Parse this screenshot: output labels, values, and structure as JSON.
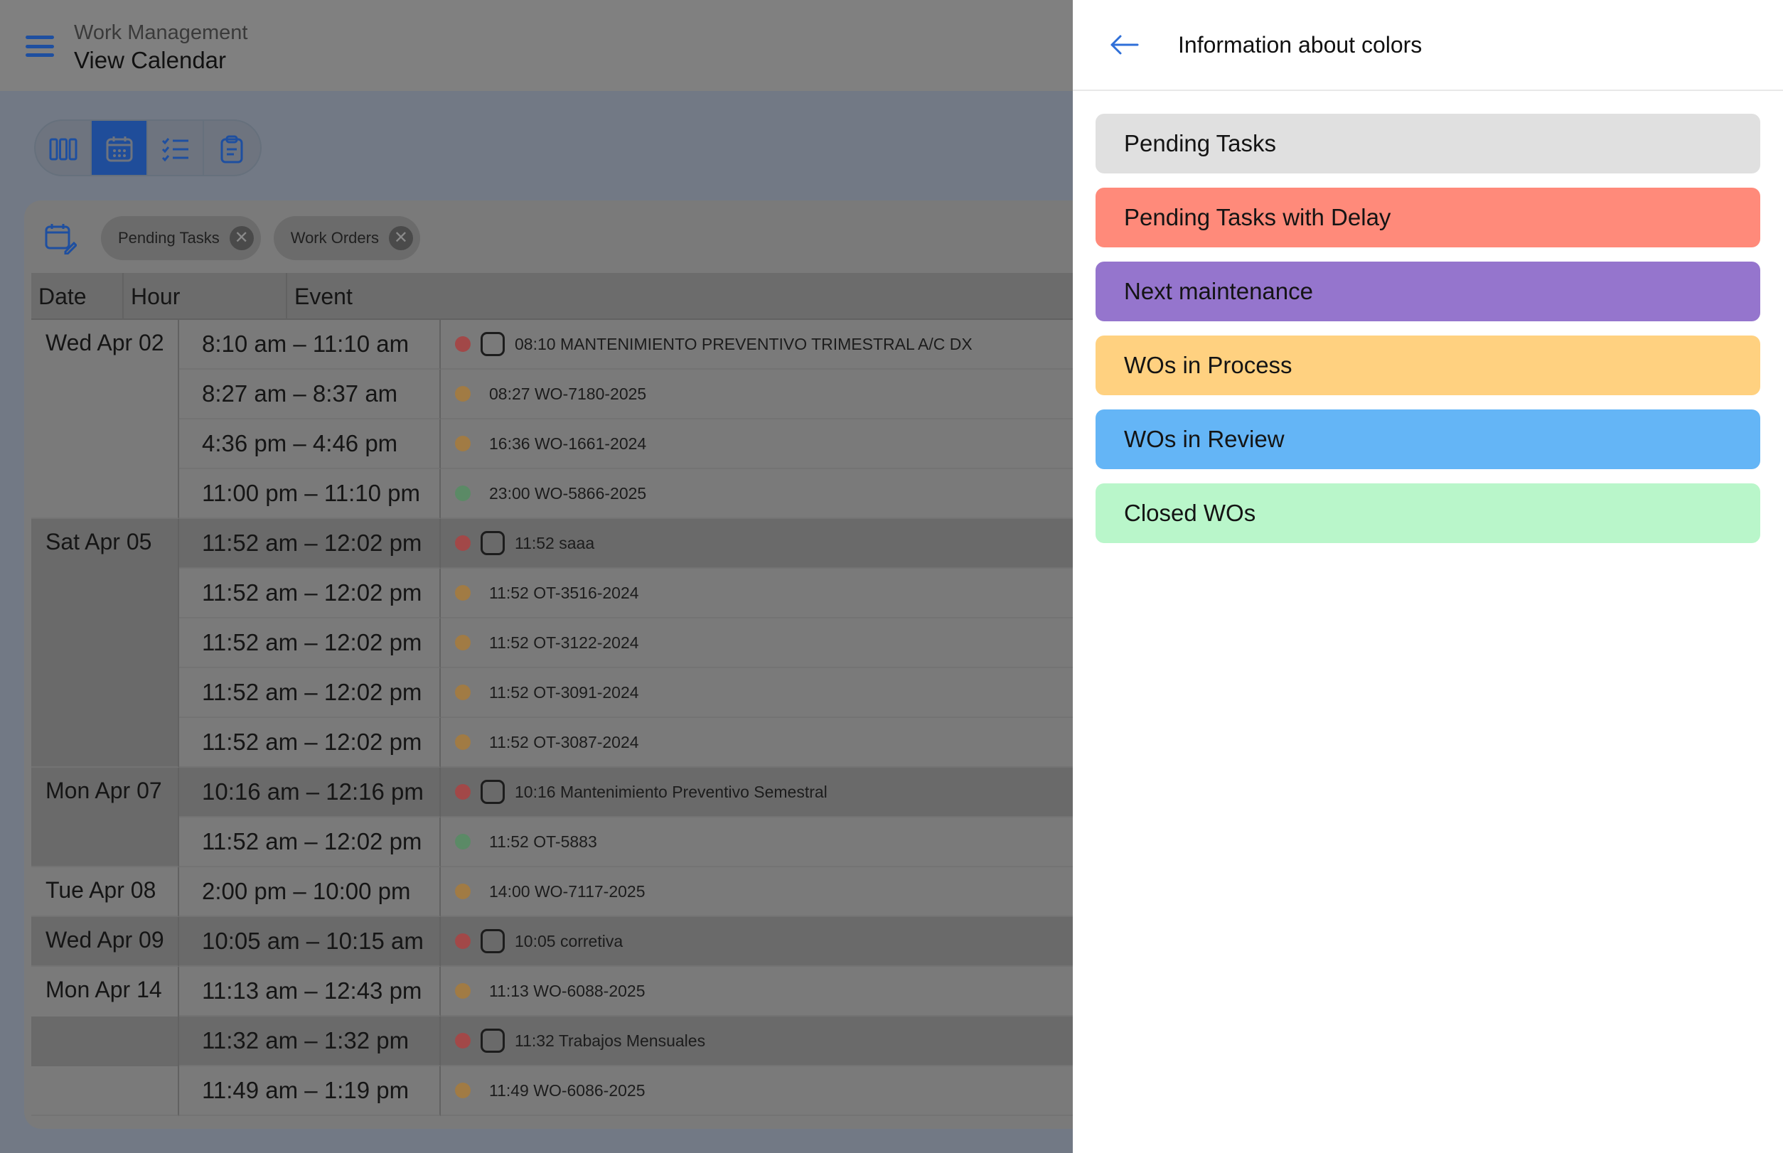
{
  "header": {
    "app_title": "Work Management",
    "page_title": "View Calendar"
  },
  "view_switch": {
    "items": [
      {
        "icon": "columns-icon",
        "active": false
      },
      {
        "icon": "calendar-icon",
        "active": true
      },
      {
        "icon": "checklist-icon",
        "active": false
      },
      {
        "icon": "clipboard-icon",
        "active": false
      }
    ]
  },
  "filters": {
    "chips": [
      {
        "label": "Pending Tasks"
      },
      {
        "label": "Work Orders"
      }
    ]
  },
  "table": {
    "columns": [
      "Date",
      "Hour",
      "Event"
    ],
    "groups": [
      {
        "date": "Wed Apr 02",
        "dark": false,
        "rows": [
          {
            "hour": "8:10 am – 11:10 am",
            "event": "08:10 MANTENIMIENTO PREVENTIVO TRIMESTRAL A/C DX",
            "dot": "red",
            "checkbox": true,
            "dark": false
          },
          {
            "hour": "8:27 am – 8:37 am",
            "event": "08:27 WO-7180-2025",
            "dot": "orange",
            "checkbox": false,
            "dark": false
          },
          {
            "hour": "4:36 pm – 4:46 pm",
            "event": "16:36 WO-1661-2024",
            "dot": "orange",
            "checkbox": false,
            "dark": false
          },
          {
            "hour": "11:00 pm – 11:10 pm",
            "event": "23:00 WO-5866-2025",
            "dot": "green",
            "checkbox": false,
            "dark": false
          }
        ]
      },
      {
        "date": "Sat Apr 05",
        "dark": true,
        "rows": [
          {
            "hour": "11:52 am – 12:02 pm",
            "event": "11:52 saaa",
            "dot": "red",
            "checkbox": true,
            "dark": true
          },
          {
            "hour": "11:52 am – 12:02 pm",
            "event": "11:52 OT-3516-2024",
            "dot": "orange",
            "checkbox": false,
            "dark": false
          },
          {
            "hour": "11:52 am – 12:02 pm",
            "event": "11:52 OT-3122-2024",
            "dot": "orange",
            "checkbox": false,
            "dark": false
          },
          {
            "hour": "11:52 am – 12:02 pm",
            "event": "11:52 OT-3091-2024",
            "dot": "orange",
            "checkbox": false,
            "dark": false
          },
          {
            "hour": "11:52 am – 12:02 pm",
            "event": "11:52 OT-3087-2024",
            "dot": "orange",
            "checkbox": false,
            "dark": false
          }
        ]
      },
      {
        "date": "Mon Apr 07",
        "dark": true,
        "rows": [
          {
            "hour": "10:16 am – 12:16 pm",
            "event": "10:16 Mantenimiento Preventivo Semestral",
            "dot": "red",
            "checkbox": true,
            "dark": true
          },
          {
            "hour": "11:52 am – 12:02 pm",
            "event": "11:52 OT-5883",
            "dot": "green",
            "checkbox": false,
            "dark": false
          }
        ]
      },
      {
        "date": "Tue Apr 08",
        "dark": false,
        "rows": [
          {
            "hour": "2:00 pm – 10:00 pm",
            "event": "14:00 WO-7117-2025",
            "dot": "orange",
            "checkbox": false,
            "dark": false
          }
        ]
      },
      {
        "date": "Wed Apr 09",
        "dark": true,
        "rows": [
          {
            "hour": "10:05 am – 10:15 am",
            "event": "10:05 corretiva",
            "dot": "red",
            "checkbox": true,
            "dark": true
          }
        ]
      },
      {
        "date": "Mon Apr 14",
        "dark": false,
        "rows": [
          {
            "hour": "11:13 am – 12:43 pm",
            "event": "11:13 WO-6088-2025",
            "dot": "orange",
            "checkbox": false,
            "dark": false
          },
          {
            "hour": "11:32 am – 1:32 pm",
            "event": "11:32 Trabajos Mensuales",
            "dot": "red",
            "checkbox": true,
            "dark": true
          },
          {
            "hour": "11:49 am – 1:19 pm",
            "event": "11:49 WO-6086-2025",
            "dot": "orange",
            "checkbox": false,
            "dark": false
          }
        ]
      }
    ]
  },
  "dot_colors": {
    "red": "#a24848",
    "orange": "#a17b44",
    "green": "#5b8a66"
  },
  "panel": {
    "title": "Information about colors",
    "legend": [
      {
        "label": "Pending Tasks",
        "color": "#e0e0e0"
      },
      {
        "label": "Pending Tasks with Delay",
        "color": "#ff8a7a"
      },
      {
        "label": "Next maintenance",
        "color": "#9575cd"
      },
      {
        "label": "WOs in Process",
        "color": "#ffd180"
      },
      {
        "label": "WOs in Review",
        "color": "#64b5f6"
      },
      {
        "label": "Closed WOs",
        "color": "#b9f6ca"
      }
    ]
  }
}
